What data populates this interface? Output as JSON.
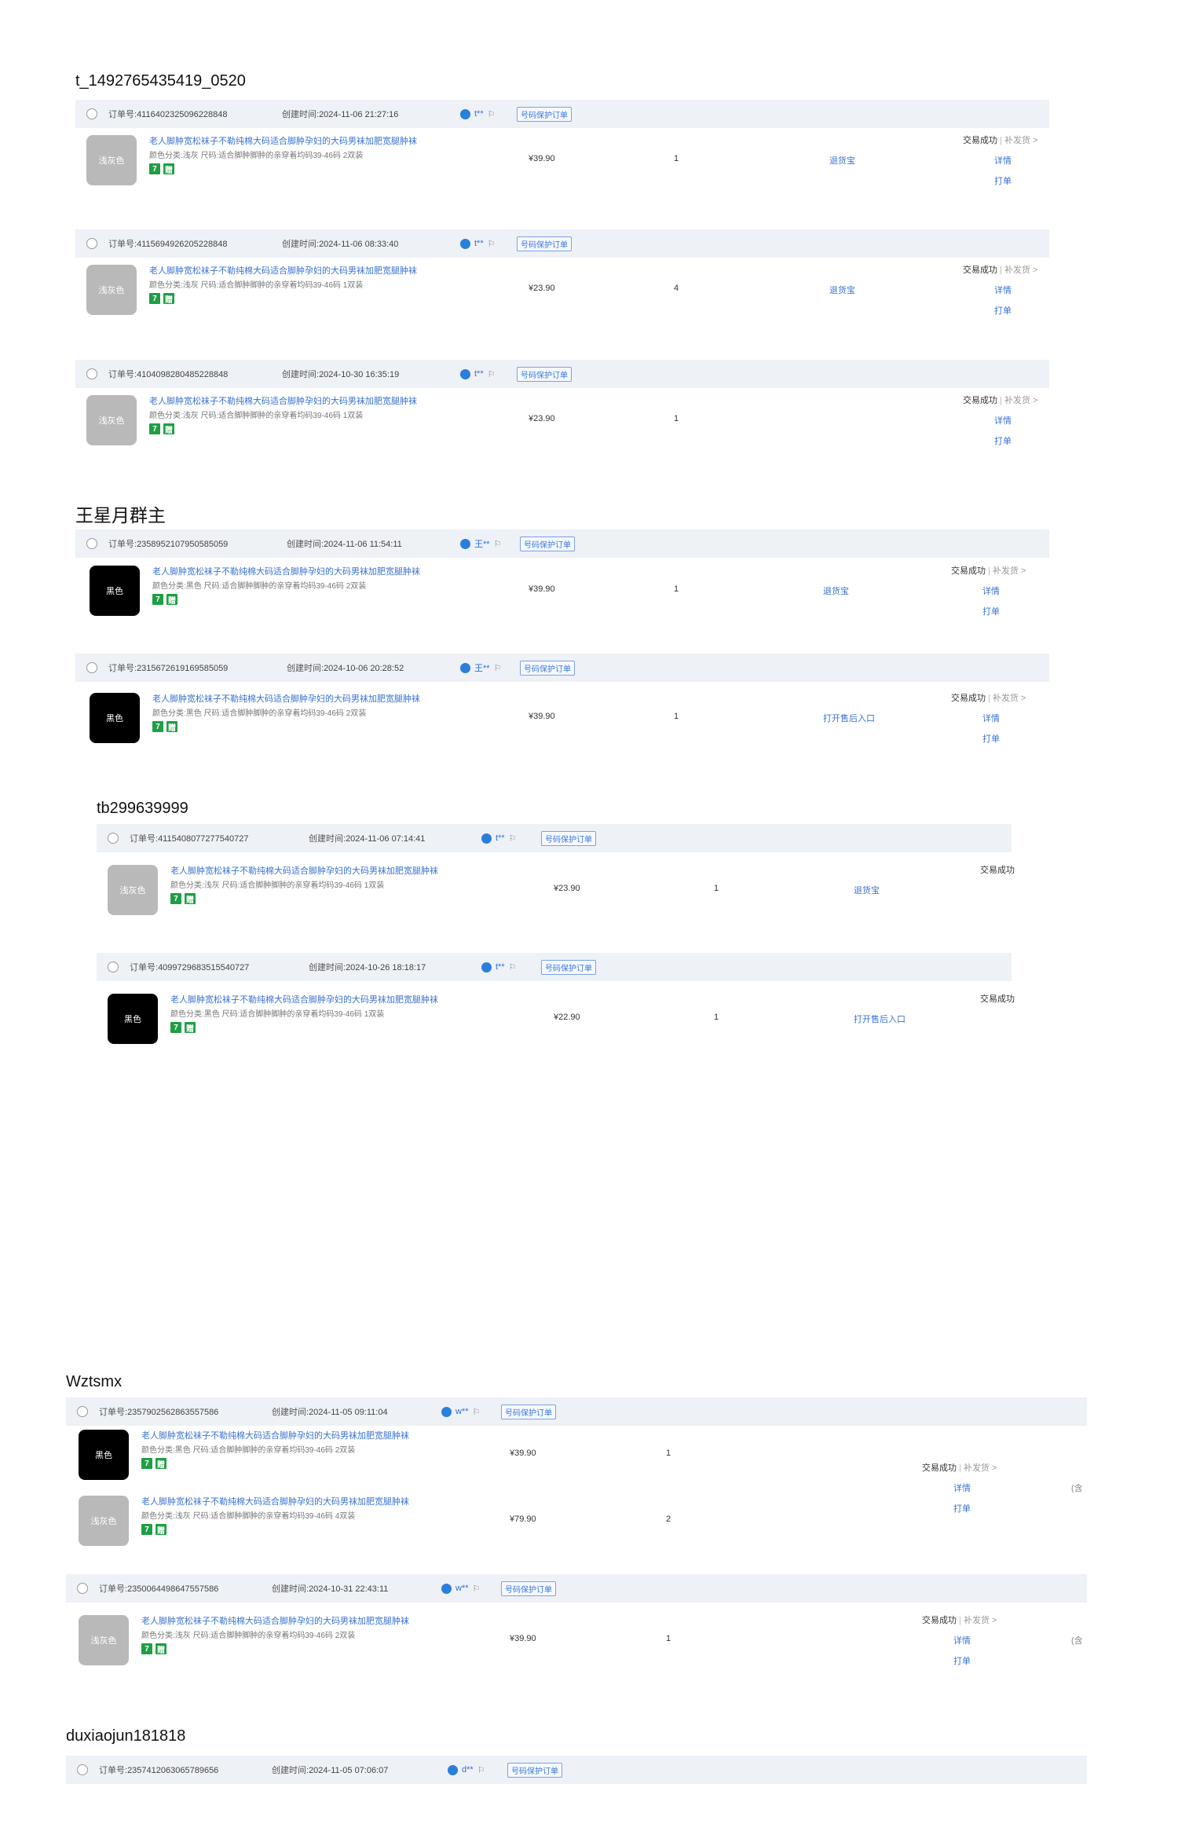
{
  "labels": {
    "order_no": "订单号:",
    "created": "创建时间:",
    "protect": "号码保护订单",
    "title": "老人脚肿宽松袜子不勒纯棉大码适合脚肿孕妇的大码男袜加肥宽腿肿袜",
    "detail": "详情",
    "print": "打单",
    "after": "补发货 >",
    "status_ok": "交易成功",
    "badge_a": "7",
    "badge_b": "赠"
  },
  "groups": [
    {
      "username": "t_1492765435419_0520",
      "orders": [
        {
          "order_no": "4116402325096228848",
          "created": "2024-11-06 21:27:16",
          "buyer": "t**",
          "items": [
            {
              "thumb": "浅灰色",
              "sku": "颜色分类:浅灰 尺码:适合脚肿脚肿的亲穿着均码39-46码 2双装",
              "price": "¥39.90",
              "qty": "1"
            }
          ],
          "service": "退货宝"
        },
        {
          "order_no": "4115694926205228848",
          "created": "2024-11-06 08:33:40",
          "buyer": "t**",
          "items": [
            {
              "thumb": "浅灰色",
              "sku": "颜色分类:浅灰 尺码:适合脚肿脚肿的亲穿着均码39-46码 1双装",
              "price": "¥23.90",
              "qty": "4"
            }
          ],
          "service": "退货宝"
        },
        {
          "order_no": "4104098280485228848",
          "created": "2024-10-30 16:35:19",
          "buyer": "t**",
          "items": [
            {
              "thumb": "浅灰色",
              "sku": "颜色分类:浅灰 尺码:适合脚肿脚肿的亲穿着均码39-46码 1双装",
              "price": "¥23.90",
              "qty": "1"
            }
          ],
          "service": ""
        }
      ]
    },
    {
      "username": "王星月群主",
      "orders": [
        {
          "order_no": "2358952107950585059",
          "created": "2024-11-06 11:54:11",
          "buyer": "王**",
          "items": [
            {
              "thumb": "黑色",
              "sku": "颜色分类:黑色 尺码:适合脚肿脚肿的亲穿着均码39-46码 2双装",
              "price": "¥39.90",
              "qty": "1"
            }
          ],
          "service": "退货宝"
        },
        {
          "order_no": "2315672619169585059",
          "created": "2024-10-06 20:28:52",
          "buyer": "王**",
          "items": [
            {
              "thumb": "黑色",
              "sku": "颜色分类:黑色 尺码:适合脚肿脚肿的亲穿着均码39-46码 2双装",
              "price": "¥39.90",
              "qty": "1"
            }
          ],
          "service": "打开售后入口"
        }
      ]
    },
    {
      "username": "tb299639999",
      "orders": [
        {
          "order_no": "4115408077277540727",
          "created": "2024-11-06 07:14:41",
          "buyer": "t**",
          "items": [
            {
              "thumb": "浅灰色",
              "sku": "颜色分类:浅灰 尺码:适合脚肿脚肿的亲穿着均码39-46码 1双装",
              "price": "¥23.90",
              "qty": "1"
            }
          ],
          "service": "退货宝"
        },
        {
          "order_no": "4099729683515540727",
          "created": "2024-10-26 18:18:17",
          "buyer": "t**",
          "items": [
            {
              "thumb": "黑色",
              "sku": "颜色分类:黑色 尺码:适合脚肿脚肿的亲穿着均码39-46码 1双装",
              "price": "¥22.90",
              "qty": "1"
            }
          ],
          "service": "打开售后入口"
        }
      ]
    },
    {
      "username": "Wztsmx",
      "orders": [
        {
          "order_no": "2357902562863557586",
          "created": "2024-11-05 09:11:04",
          "buyer": "w**",
          "items": [
            {
              "thumb": "黑色",
              "sku": "颜色分类:黑色 尺码:适合脚肿脚肿的亲穿着均码39-46码 2双装",
              "price": "¥39.90",
              "qty": "1"
            },
            {
              "thumb": "浅灰色",
              "sku": "颜色分类:浅灰 尺码:适合脚肿脚肿的亲穿着均码39-46码 4双装",
              "price": "¥79.90",
              "qty": "2"
            }
          ],
          "service": "",
          "extra": "(含"
        },
        {
          "order_no": "2350064498647557586",
          "created": "2024-10-31 22:43:11",
          "buyer": "w**",
          "items": [
            {
              "thumb": "浅灰色",
              "sku": "颜色分类:浅灰 尺码:适合脚肿脚肿的亲穿着均码39-46码 2双装",
              "price": "¥39.90",
              "qty": "1"
            }
          ],
          "service": "",
          "extra": "(含"
        }
      ]
    },
    {
      "username": "duxiaojun181818",
      "orders": [
        {
          "order_no": "2357412063065789656",
          "created": "2024-11-05 07:06:07",
          "buyer": "d**",
          "items": [],
          "service": ""
        }
      ]
    }
  ],
  "colors": {
    "header_bg": "#eef1f6",
    "link": "#3a72d0",
    "badge": "#1f9e45",
    "thumb_grey": "#b9b9b9"
  }
}
